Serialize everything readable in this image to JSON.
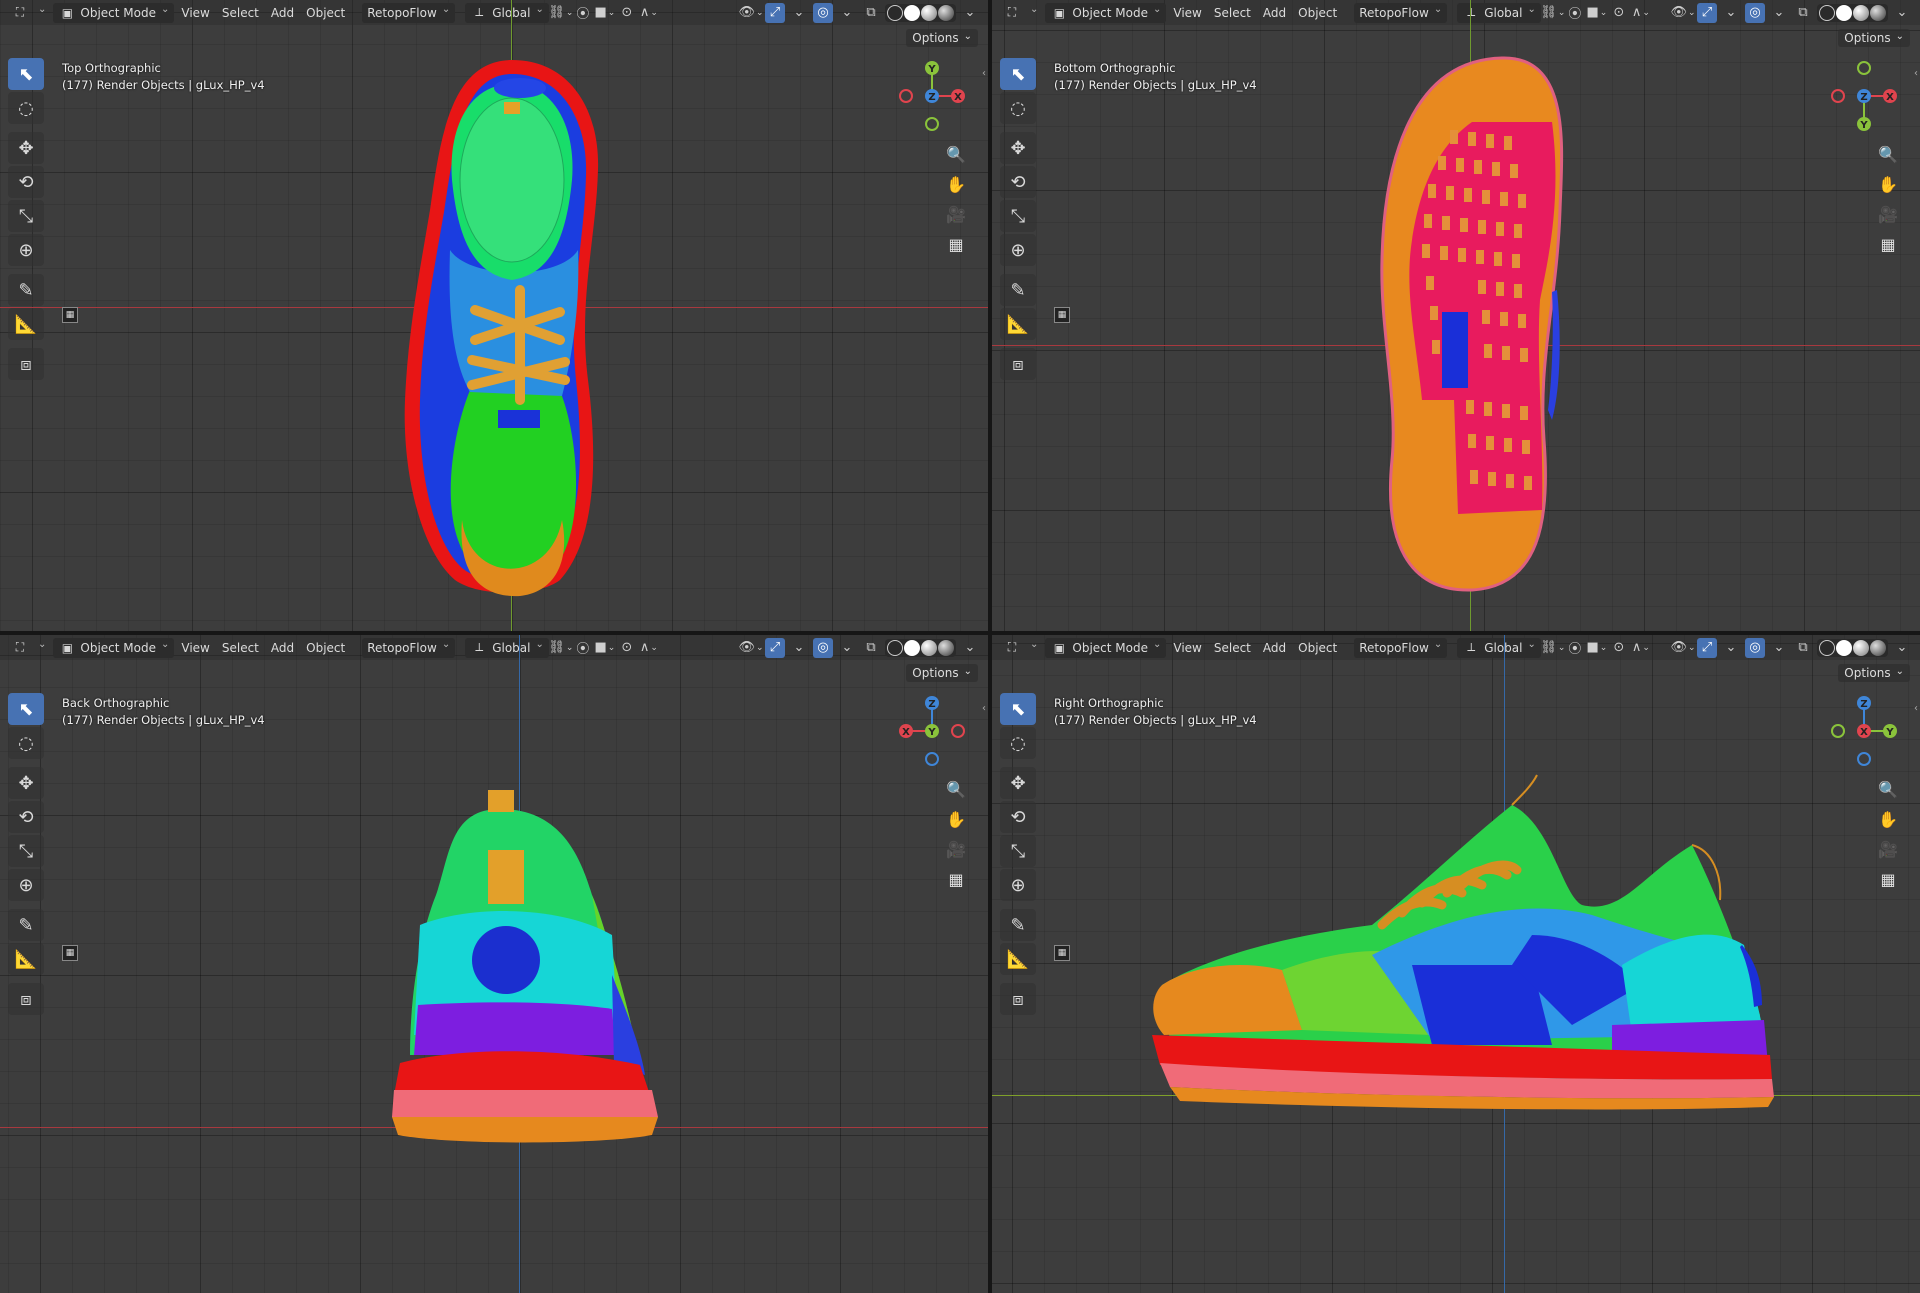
{
  "header": {
    "mode_label": "Object Mode",
    "menus": [
      "View",
      "Select",
      "Add",
      "Object"
    ],
    "addon_label": "RetopoFlow",
    "orientation_label": "Global",
    "options_label": "Options"
  },
  "viewports": [
    {
      "view_name": "Top Orthographic",
      "info": "(177) Render Objects | gLux_HP_v4"
    },
    {
      "view_name": "Bottom Orthographic",
      "info": "(177) Render Objects | gLux_HP_v4"
    },
    {
      "view_name": "Back Orthographic",
      "info": "(177) Render Objects | gLux_HP_v4"
    },
    {
      "view_name": "Right Orthographic",
      "info": "(177) Render Objects | gLux_HP_v4"
    }
  ],
  "gizmo_labels": {
    "x": "X",
    "y": "Y",
    "z": "Z"
  },
  "icons": {
    "toolbar": [
      "select-box-icon",
      "cursor-icon",
      "move-icon",
      "rotate-icon",
      "scale-icon",
      "transform-icon",
      "annotate-icon",
      "measure-icon",
      "add-cube-icon"
    ],
    "nav": [
      "zoom-icon",
      "pan-hand-icon",
      "camera-icon",
      "grid-icon"
    ]
  },
  "colors": {
    "accent": "#4772b3",
    "axis_x": "#e0444e",
    "axis_y": "#8ac33b",
    "axis_z": "#3f86d8",
    "viewport_bg": "#3d3d3d"
  }
}
